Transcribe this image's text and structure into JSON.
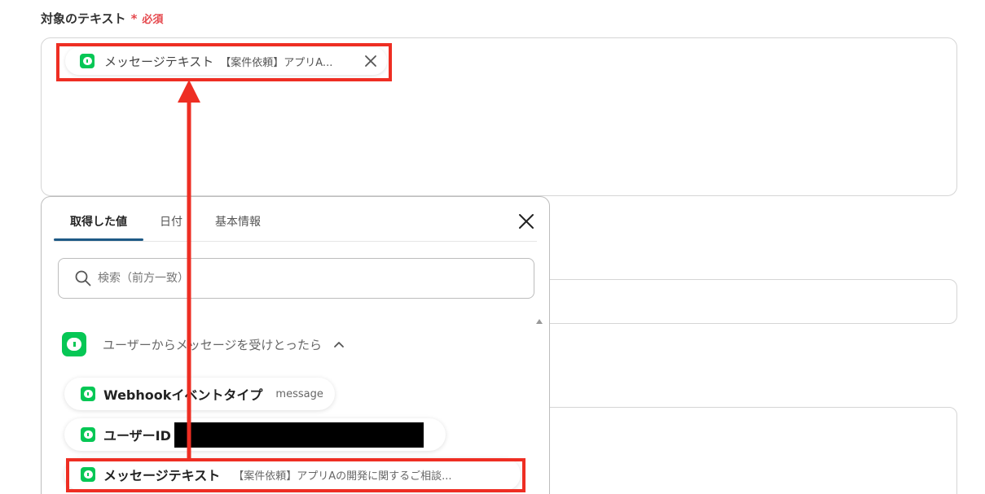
{
  "field": {
    "label": "対象のテキスト",
    "required_mark": "*",
    "required_text": "必須"
  },
  "token": {
    "name": "メッセージテキスト",
    "value": "【案件依頼】アプリA..."
  },
  "picker": {
    "tabs": [
      {
        "label": "取得した値",
        "active": true
      },
      {
        "label": "日付",
        "active": false
      },
      {
        "label": "基本情報",
        "active": false
      }
    ],
    "search_placeholder": "検索（前方一致）",
    "section": {
      "title": "ユーザーからメッセージを受けとったら",
      "expanded": true
    },
    "items": [
      {
        "label": "Webhookイベントタイプ",
        "value": "message"
      },
      {
        "label": "ユーザーID",
        "value": "",
        "redacted": true
      },
      {
        "label": "メッセージテキスト",
        "value": "【案件依頼】アプリAの開発に関するご相談..."
      }
    ]
  },
  "colors": {
    "line_green": "#06c755",
    "required_red": "#e5484d",
    "highlight_red": "#ee2e23",
    "active_tab": "#1e5a86"
  },
  "icons": [
    "line-app-icon",
    "close-icon",
    "search-icon",
    "chevron-up-icon",
    "arrow-up-annotation"
  ]
}
